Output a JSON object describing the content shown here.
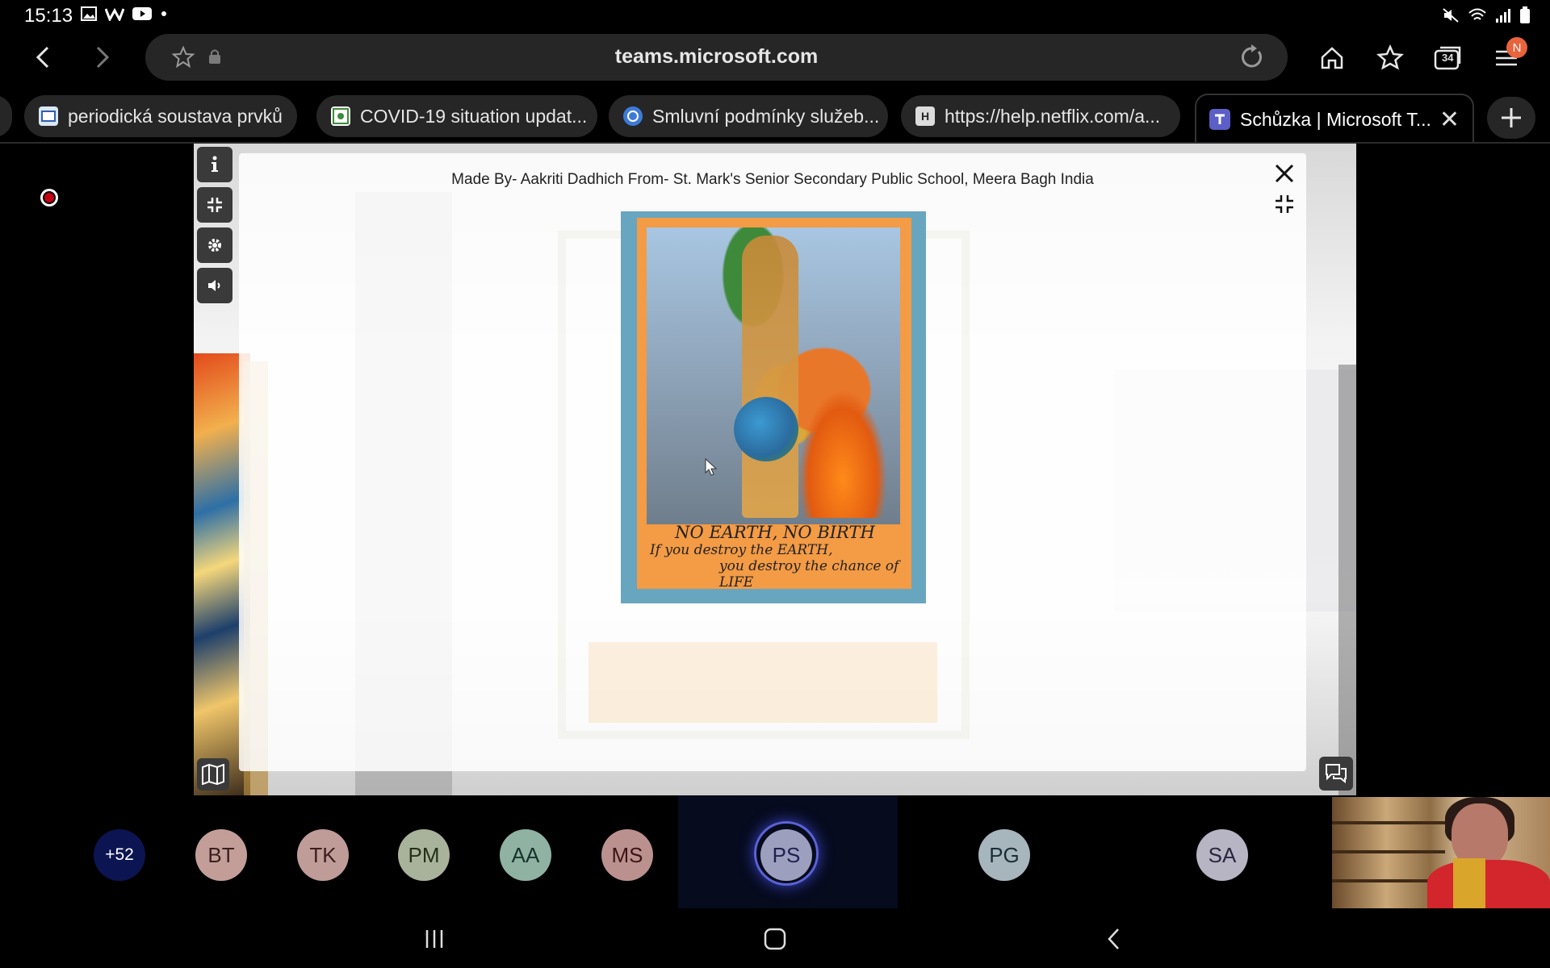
{
  "status_bar": {
    "time": "15:13",
    "left_icons": [
      "image-icon",
      "w-app-icon",
      "youtube-icon",
      "dot-icon"
    ],
    "right_icons": [
      "mute-icon",
      "wifi-icon",
      "signal-icon",
      "battery-icon"
    ]
  },
  "browser": {
    "url": "teams.microsoft.com",
    "tab_count": "34",
    "profile_initial": "N",
    "tabs": [
      {
        "label": "periodická soustava prvků",
        "icon": "document-favicon"
      },
      {
        "label": "COVID-19 situation updat...",
        "icon": "covid-favicon"
      },
      {
        "label": "Smluvní podmínky služeb...",
        "icon": "globe-favicon"
      },
      {
        "label": "https://help.netflix.com/a...",
        "icon": "h-favicon",
        "favicon_letter": "H"
      },
      {
        "label": "Schůzka | Microsoft T...",
        "icon": "teams-favicon",
        "active": true
      }
    ]
  },
  "gallery_modal": {
    "title": "Made By- Aakriti Dadhich From- St. Mark's Senior Secondary Public School, Meera Bagh India",
    "artwork_caption": {
      "line1": "NO EARTH, NO BIRTH",
      "line2": "If you destroy the EARTH,",
      "line3": "you destroy the chance of LIFE"
    }
  },
  "participants": {
    "overflow": "+52",
    "people": [
      {
        "initials": "BT",
        "bg": "#c39e99",
        "fg": "#3b1f1d"
      },
      {
        "initials": "TK",
        "bg": "#bf9c98",
        "fg": "#3b1f1d"
      },
      {
        "initials": "PM",
        "bg": "#a9b29a",
        "fg": "#243018"
      },
      {
        "initials": "AA",
        "bg": "#8fb2a2",
        "fg": "#16342a"
      },
      {
        "initials": "MS",
        "bg": "#bb918f",
        "fg": "#3b1515"
      },
      {
        "initials": "PS",
        "bg": "#9d9fbf",
        "fg": "#1e2150",
        "speaking": true
      },
      {
        "initials": "PG",
        "bg": "#a7b6bd",
        "fg": "#1c2e36"
      },
      {
        "initials": "SA",
        "bg": "#b7b4c4",
        "fg": "#2b2540"
      }
    ],
    "overflow_bg": "#0c1552"
  },
  "colors": {
    "record": "#c40012",
    "active_ring": "#5b63d6",
    "profile": "#e8643c"
  }
}
